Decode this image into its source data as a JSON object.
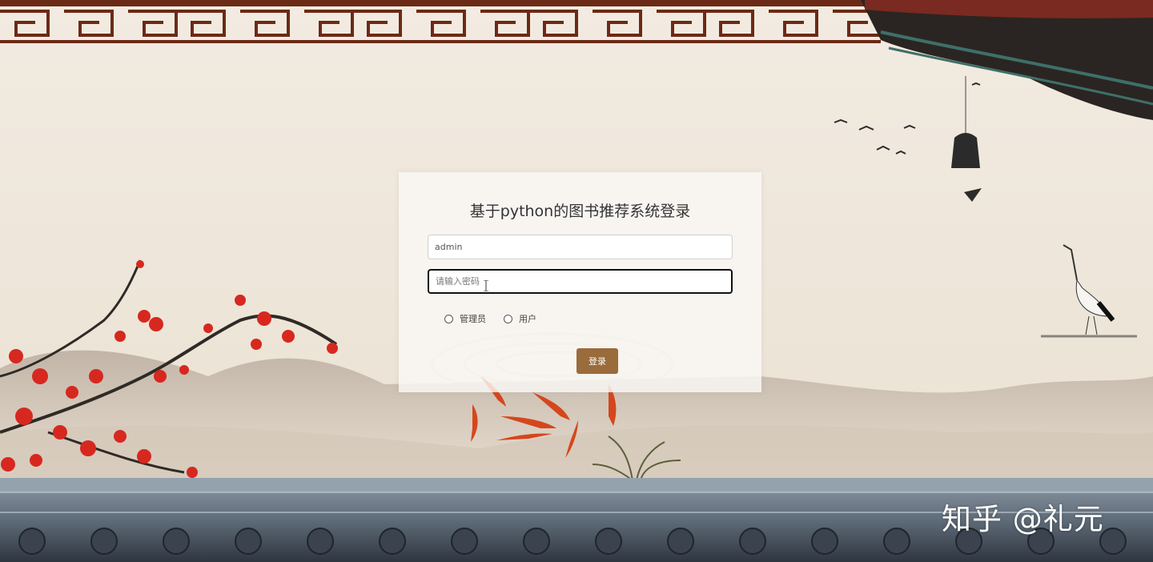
{
  "login": {
    "title": "基于python的图书推荐系统登录",
    "username_value": "admin",
    "password_placeholder": "请输入密码",
    "roles": [
      "管理员",
      "用户"
    ],
    "submit_label": "登录"
  },
  "watermark": "知乎 @礼元",
  "colors": {
    "button": "#9a6b3b",
    "frame": "#6b2a16",
    "background": "#efe6d8"
  }
}
